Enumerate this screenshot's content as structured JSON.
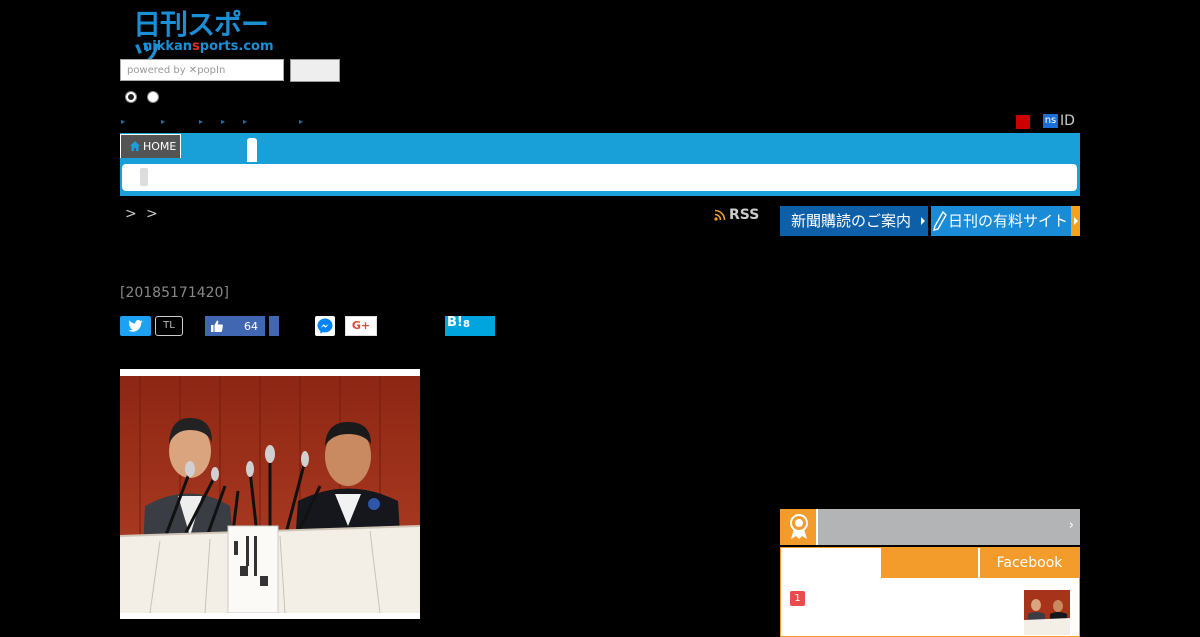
{
  "logo": {
    "main": "日刊スポーツ",
    "sub_a": "nikkan",
    "sub_b": "s",
    "sub_c": "ports.com"
  },
  "search": {
    "placeholder": "powered by ✕popIn"
  },
  "header": {
    "ns_label": "ns",
    "id_label": "ID"
  },
  "nav": {
    "home_label": "HOME"
  },
  "breadcrumb": {
    "sep1": ">",
    "sep2": ">"
  },
  "rss": {
    "label": "RSS"
  },
  "banners": {
    "subscribe": "新聞購読のご案内",
    "paid_site": "日刊の有料サイト"
  },
  "article": {
    "date": "[20185171420]"
  },
  "share": {
    "tl_label": "TL",
    "like_count": "64",
    "gplus_label": "G+",
    "hatena_label": "B!",
    "hatena_count": "8"
  },
  "ranking": {
    "number": "1",
    "tab_facebook": "Facebook",
    "arrow": "›"
  },
  "colors": {
    "nav_blue": "#19a0d8",
    "accent_orange": "#f39c2c",
    "twitter": "#1da1f2",
    "facebook": "#4267b2",
    "hatena": "#00a4de"
  }
}
